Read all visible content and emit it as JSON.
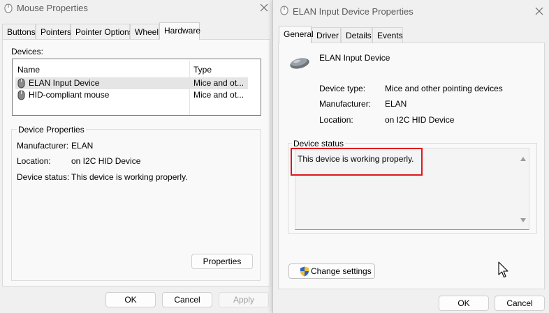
{
  "mouse_window": {
    "title": "Mouse Properties",
    "tabs": [
      "Buttons",
      "Pointers",
      "Pointer Options",
      "Wheel",
      "Hardware"
    ],
    "active_tab": "Hardware",
    "devices_label": "Devices:",
    "columns": [
      "Name",
      "Type"
    ],
    "devices": [
      {
        "name": "ELAN Input Device",
        "type": "Mice and ot..."
      },
      {
        "name": "HID-compliant mouse",
        "type": "Mice and ot..."
      }
    ],
    "device_properties": {
      "heading": "Device Properties",
      "manufacturer_label": "Manufacturer:",
      "manufacturer_value": "ELAN",
      "location_label": "Location:",
      "location_value": "on I2C HID Device",
      "status_label": "Device status:",
      "status_value": "This device is working properly."
    },
    "properties_button": "Properties",
    "ok_button": "OK",
    "cancel_button": "Cancel",
    "apply_button": "Apply"
  },
  "elan_window": {
    "title": "ELAN Input Device Properties",
    "tabs": [
      "General",
      "Driver",
      "Details",
      "Events"
    ],
    "active_tab": "General",
    "device_name": "ELAN Input Device",
    "device_type_label": "Device type:",
    "device_type_value": "Mice and other pointing devices",
    "manufacturer_label": "Manufacturer:",
    "manufacturer_value": "ELAN",
    "location_label": "Location:",
    "location_value": "on I2C HID Device",
    "status_heading": "Device status",
    "status_text": "This device is working properly.",
    "change_settings_button": "Change settings",
    "ok_button": "OK",
    "cancel_button": "Cancel"
  },
  "colors": {
    "highlight_box": "#e0161e",
    "selected_row": "#e5e5e5",
    "window_bg": "#f0f0f0",
    "panel_bg": "#f9f9f9"
  }
}
